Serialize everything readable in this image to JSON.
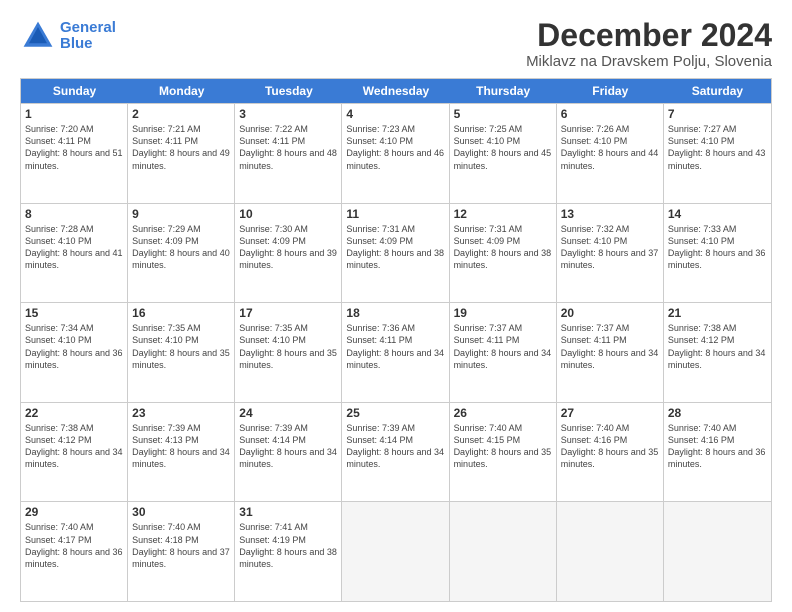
{
  "logo": {
    "line1": "General",
    "line2": "Blue"
  },
  "title": "December 2024",
  "subtitle": "Miklavz na Dravskem Polju, Slovenia",
  "days_of_week": [
    "Sunday",
    "Monday",
    "Tuesday",
    "Wednesday",
    "Thursday",
    "Friday",
    "Saturday"
  ],
  "weeks": [
    [
      {
        "day": 1,
        "sunrise": "7:20 AM",
        "sunset": "4:11 PM",
        "daylight": "8 hours and 51 minutes."
      },
      {
        "day": 2,
        "sunrise": "7:21 AM",
        "sunset": "4:11 PM",
        "daylight": "8 hours and 49 minutes."
      },
      {
        "day": 3,
        "sunrise": "7:22 AM",
        "sunset": "4:11 PM",
        "daylight": "8 hours and 48 minutes."
      },
      {
        "day": 4,
        "sunrise": "7:23 AM",
        "sunset": "4:10 PM",
        "daylight": "8 hours and 46 minutes."
      },
      {
        "day": 5,
        "sunrise": "7:25 AM",
        "sunset": "4:10 PM",
        "daylight": "8 hours and 45 minutes."
      },
      {
        "day": 6,
        "sunrise": "7:26 AM",
        "sunset": "4:10 PM",
        "daylight": "8 hours and 44 minutes."
      },
      {
        "day": 7,
        "sunrise": "7:27 AM",
        "sunset": "4:10 PM",
        "daylight": "8 hours and 43 minutes."
      }
    ],
    [
      {
        "day": 8,
        "sunrise": "7:28 AM",
        "sunset": "4:10 PM",
        "daylight": "8 hours and 41 minutes."
      },
      {
        "day": 9,
        "sunrise": "7:29 AM",
        "sunset": "4:09 PM",
        "daylight": "8 hours and 40 minutes."
      },
      {
        "day": 10,
        "sunrise": "7:30 AM",
        "sunset": "4:09 PM",
        "daylight": "8 hours and 39 minutes."
      },
      {
        "day": 11,
        "sunrise": "7:31 AM",
        "sunset": "4:09 PM",
        "daylight": "8 hours and 38 minutes."
      },
      {
        "day": 12,
        "sunrise": "7:31 AM",
        "sunset": "4:09 PM",
        "daylight": "8 hours and 38 minutes."
      },
      {
        "day": 13,
        "sunrise": "7:32 AM",
        "sunset": "4:10 PM",
        "daylight": "8 hours and 37 minutes."
      },
      {
        "day": 14,
        "sunrise": "7:33 AM",
        "sunset": "4:10 PM",
        "daylight": "8 hours and 36 minutes."
      }
    ],
    [
      {
        "day": 15,
        "sunrise": "7:34 AM",
        "sunset": "4:10 PM",
        "daylight": "8 hours and 36 minutes."
      },
      {
        "day": 16,
        "sunrise": "7:35 AM",
        "sunset": "4:10 PM",
        "daylight": "8 hours and 35 minutes."
      },
      {
        "day": 17,
        "sunrise": "7:35 AM",
        "sunset": "4:10 PM",
        "daylight": "8 hours and 35 minutes."
      },
      {
        "day": 18,
        "sunrise": "7:36 AM",
        "sunset": "4:11 PM",
        "daylight": "8 hours and 34 minutes."
      },
      {
        "day": 19,
        "sunrise": "7:37 AM",
        "sunset": "4:11 PM",
        "daylight": "8 hours and 34 minutes."
      },
      {
        "day": 20,
        "sunrise": "7:37 AM",
        "sunset": "4:11 PM",
        "daylight": "8 hours and 34 minutes."
      },
      {
        "day": 21,
        "sunrise": "7:38 AM",
        "sunset": "4:12 PM",
        "daylight": "8 hours and 34 minutes."
      }
    ],
    [
      {
        "day": 22,
        "sunrise": "7:38 AM",
        "sunset": "4:12 PM",
        "daylight": "8 hours and 34 minutes."
      },
      {
        "day": 23,
        "sunrise": "7:39 AM",
        "sunset": "4:13 PM",
        "daylight": "8 hours and 34 minutes."
      },
      {
        "day": 24,
        "sunrise": "7:39 AM",
        "sunset": "4:14 PM",
        "daylight": "8 hours and 34 minutes."
      },
      {
        "day": 25,
        "sunrise": "7:39 AM",
        "sunset": "4:14 PM",
        "daylight": "8 hours and 34 minutes."
      },
      {
        "day": 26,
        "sunrise": "7:40 AM",
        "sunset": "4:15 PM",
        "daylight": "8 hours and 35 minutes."
      },
      {
        "day": 27,
        "sunrise": "7:40 AM",
        "sunset": "4:16 PM",
        "daylight": "8 hours and 35 minutes."
      },
      {
        "day": 28,
        "sunrise": "7:40 AM",
        "sunset": "4:16 PM",
        "daylight": "8 hours and 36 minutes."
      }
    ],
    [
      {
        "day": 29,
        "sunrise": "7:40 AM",
        "sunset": "4:17 PM",
        "daylight": "8 hours and 36 minutes."
      },
      {
        "day": 30,
        "sunrise": "7:40 AM",
        "sunset": "4:18 PM",
        "daylight": "8 hours and 37 minutes."
      },
      {
        "day": 31,
        "sunrise": "7:41 AM",
        "sunset": "4:19 PM",
        "daylight": "8 hours and 38 minutes."
      },
      null,
      null,
      null,
      null
    ]
  ]
}
